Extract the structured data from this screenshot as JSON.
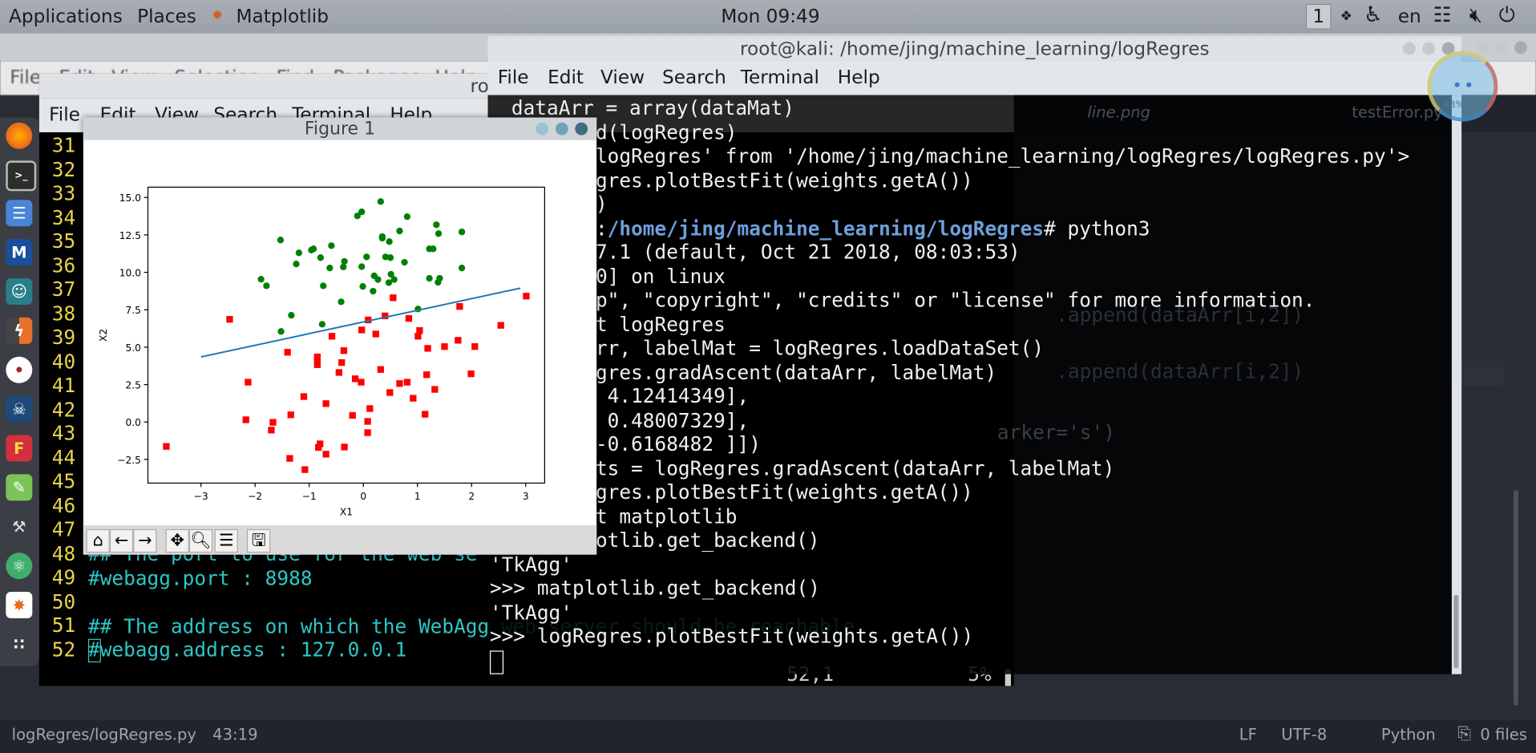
{
  "topbar": {
    "applications": "Applications",
    "places": "Places",
    "app_name": "Matplotlib",
    "clock": "Mon 09:49",
    "workspace": "1",
    "lang": "en"
  },
  "atom": {
    "menu": [
      "File",
      "Edit",
      "View",
      "Selection",
      "Find",
      "Packages",
      "Help"
    ],
    "tabs": [
      "line.png",
      "testError.py"
    ],
    "ghost_lines": [
      ".append(dataArr[i,2])",
      ".append(dataArr[i,2])",
      "arker='s')"
    ],
    "status": {
      "file": "logRegres/logRegres.py",
      "cursor": "43:19",
      "line_ending": "LF",
      "encoding": "UTF-8",
      "grammar": "Python",
      "files": "0 files"
    }
  },
  "net_widget": {
    "percent": "93%"
  },
  "vim_terminal": {
    "title": "ro",
    "menu": [
      "File",
      "Edit",
      "View",
      "Search",
      "Terminal",
      "Help"
    ],
    "line_numbers": [
      "31",
      "32",
      "33",
      "34",
      "35",
      "36",
      "37",
      "38",
      "39",
      "40",
      "41",
      "42",
      "43",
      "44",
      "45",
      "46",
      "47",
      "48",
      "49",
      "50",
      "51",
      "52"
    ],
    "lines": {
      "48": "## The port to use for the web se",
      "49": "#webagg.port : 8988",
      "50": "",
      "51": "## The address on which the WebAgg web server should be reachable",
      "52": "#webagg.address : 127.0.0.1"
    },
    "position": "52,1",
    "percent": "5%"
  },
  "big_terminal": {
    "title": "root@kali: /home/jing/machine_learning/logRegres",
    "menu": [
      "File",
      "Edit",
      "View",
      "Search",
      "Terminal",
      "Help"
    ],
    "lines": [
      "dataArr = array(dataMat)",
      "d(logRegres)",
      "logRegres' from '/home/jing/machine_learning/logRegres/logRegres.py'>",
      "gres.plotBestFit(weights.getA())",
      ")",
      "",
      "7.1 (default, Oct 21 2018, 08:03:53)",
      "0] on linux",
      "p\", \"copyright\", \"credits\" or \"license\" for more information.",
      "t logRegres",
      "rr, labelMat = logRegres.loadDataSet()",
      "gres.gradAscent(dataArr, labelMat)",
      " 4.12414349],",
      " 0.48007329],",
      "-0.6168482 ]])",
      "ts = logRegres.gradAscent(dataArr, labelMat)",
      "gres.plotBestFit(weights.getA())",
      "t matplotlib",
      "otlib.get_backend()",
      "'TkAgg'",
      ">>> matplotlib.get_backend()",
      "'TkAgg'",
      ">>> logRegres.plotBestFit(weights.getA())"
    ],
    "prompt": {
      "prefix": ":",
      "path": "/home/jing/machine_learning/logRegres",
      "suffix": "# python3"
    }
  },
  "figure": {
    "title": "Figure 1",
    "toolbar": [
      "home",
      "back",
      "forward",
      "pan",
      "zoom",
      "configure-subplots",
      "save"
    ]
  },
  "chart_data": {
    "type": "scatter",
    "xlabel": "X1",
    "ylabel": "X2",
    "xlim": [
      -3.98,
      3.35
    ],
    "ylim": [
      -4.08,
      15.69
    ],
    "xticks": [
      -3,
      -2,
      -1,
      0,
      1,
      2,
      3
    ],
    "xtick_labels": [
      "−3",
      "−2",
      "−1",
      "0",
      "1",
      "2",
      "3"
    ],
    "yticks": [
      -2.5,
      0,
      2.5,
      5,
      7.5,
      10,
      12.5,
      15
    ],
    "ytick_labels": [
      "−2.5",
      "0.0",
      "2.5",
      "5.0",
      "7.5",
      "10.0",
      "12.5",
      "15.0"
    ],
    "grid": false,
    "series": [
      {
        "marker": "circle",
        "color": "#008000",
        "points": [
          [
            -1.53,
            12.16
          ],
          [
            -1.19,
            11.3
          ],
          [
            -1.24,
            10.56
          ],
          [
            -0.96,
            11.49
          ],
          [
            -0.92,
            11.57
          ],
          [
            -0.79,
            10.98
          ],
          [
            -0.59,
            11.78
          ],
          [
            -0.62,
            10.29
          ],
          [
            -0.35,
            10.73
          ],
          [
            -0.37,
            10.36
          ],
          [
            -0.11,
            13.77
          ],
          [
            -0.03,
            14.04
          ],
          [
            0.32,
            14.73
          ],
          [
            0.06,
            11.03
          ],
          [
            -0.03,
            10.38
          ],
          [
            0.35,
            12.39
          ],
          [
            0.35,
            12.28
          ],
          [
            0.48,
            12.05
          ],
          [
            0.67,
            12.76
          ],
          [
            0.81,
            13.72
          ],
          [
            0.41,
            11.03
          ],
          [
            0.5,
            10.98
          ],
          [
            0.76,
            10.67
          ],
          [
            0.2,
            9.77
          ],
          [
            0.27,
            9.52
          ],
          [
            0.51,
            9.87
          ],
          [
            0.57,
            9.52
          ],
          [
            0.47,
            9.31
          ],
          [
            -0.01,
            9.06
          ],
          [
            0.18,
            8.74
          ],
          [
            -0.41,
            8.03
          ],
          [
            -0.74,
            9.1
          ],
          [
            -1.89,
            9.54
          ],
          [
            -1.79,
            9.1
          ],
          [
            -1.33,
            7.13
          ],
          [
            -1.52,
            6.05
          ],
          [
            -0.76,
            6.53
          ],
          [
            1.01,
            7.55
          ],
          [
            1.22,
            11.57
          ],
          [
            1.29,
            11.57
          ],
          [
            1.35,
            13.18
          ],
          [
            1.39,
            12.59
          ],
          [
            1.82,
            12.7
          ],
          [
            1.82,
            10.29
          ],
          [
            1.22,
            9.6
          ],
          [
            1.41,
            9.6
          ],
          [
            1.38,
            9.33
          ]
        ]
      },
      {
        "marker": "square",
        "color": "#ff0000",
        "points": [
          [
            -3.64,
            -1.63
          ],
          [
            -2.47,
            6.86
          ],
          [
            -2.13,
            2.66
          ],
          [
            -2.17,
            0.15
          ],
          [
            -1.67,
            -0.02
          ],
          [
            -1.7,
            -0.54
          ],
          [
            -1.34,
            0.48
          ],
          [
            -1.36,
            -2.43
          ],
          [
            -1.08,
            -3.18
          ],
          [
            -1.1,
            1.7
          ],
          [
            -1.4,
            4.66
          ],
          [
            -0.85,
            4.35
          ],
          [
            -0.85,
            4.08
          ],
          [
            -0.85,
            3.83
          ],
          [
            -0.69,
            1.23
          ],
          [
            -0.8,
            -1.46
          ],
          [
            -0.83,
            -1.7
          ],
          [
            -0.69,
            -2.15
          ],
          [
            -0.35,
            -1.67
          ],
          [
            -0.58,
            5.73
          ],
          [
            -0.36,
            4.77
          ],
          [
            -0.4,
            3.97
          ],
          [
            -0.45,
            3.31
          ],
          [
            -0.15,
            2.89
          ],
          [
            -0.04,
            2.66
          ],
          [
            -0.2,
            0.44
          ],
          [
            0.08,
            0.04
          ],
          [
            0.08,
            -0.71
          ],
          [
            0.12,
            0.9
          ],
          [
            -0.03,
            6.15
          ],
          [
            0.09,
            6.82
          ],
          [
            0.23,
            5.88
          ],
          [
            0.32,
            3.51
          ],
          [
            0.4,
            7.09
          ],
          [
            0.55,
            8.3
          ],
          [
            0.49,
            1.97
          ],
          [
            0.67,
            2.57
          ],
          [
            0.81,
            2.66
          ],
          [
            0.92,
            1.59
          ],
          [
            0.84,
            6.92
          ],
          [
            1.04,
            6.11
          ],
          [
            1.01,
            5.73
          ],
          [
            1.19,
            4.92
          ],
          [
            1.17,
            3.16
          ],
          [
            1.32,
            2.18
          ],
          [
            1.14,
            0.52
          ],
          [
            1.5,
            5.04
          ],
          [
            1.75,
            5.46
          ],
          [
            1.78,
            7.72
          ],
          [
            1.99,
            3.22
          ],
          [
            2.06,
            5.04
          ],
          [
            2.54,
            6.46
          ],
          [
            3.01,
            8.41
          ]
        ]
      },
      {
        "marker": "line",
        "color": "#1f77b4",
        "points": [
          [
            -3.0,
            4.35
          ],
          [
            2.9,
            8.94
          ]
        ]
      }
    ]
  }
}
